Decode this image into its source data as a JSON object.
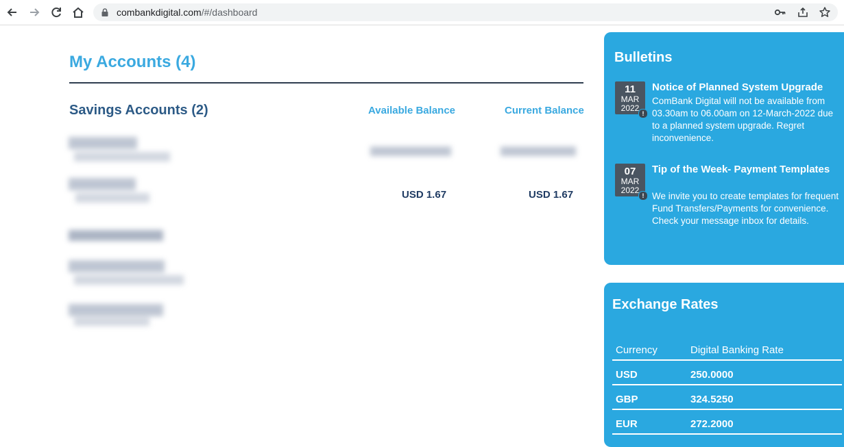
{
  "browser": {
    "url_host": "combankdigital.com",
    "url_path": "/#/dashboard"
  },
  "main": {
    "title": "My Accounts (4)",
    "savings_title": "Savings Accounts (2)",
    "col_available": "Available Balance",
    "col_current": "Current Balance",
    "accounts": [
      {
        "available": "",
        "current": ""
      },
      {
        "available": "USD 1.67",
        "current": "USD 1.67"
      }
    ]
  },
  "bulletins": {
    "title": "Bulletins",
    "items": [
      {
        "day": "11",
        "month": "MAR",
        "year": "2022",
        "title": "Notice of Planned System Upgrade",
        "text": "ComBank Digital will not be available from 03.30am to 06.00am on 12-March-2022 due to a planned system upgrade. Regret inconvenience."
      },
      {
        "day": "07",
        "month": "MAR",
        "year": "2022",
        "title": "Tip of the Week- Payment Templates",
        "text": "We invite you to create templates for frequent Fund Transfers/Payments for convenience. Check your message inbox for details."
      }
    ]
  },
  "rates": {
    "title": "Exchange Rates",
    "col_currency": "Currency",
    "col_rate": "Digital Banking Rate",
    "rows": [
      {
        "currency": "USD",
        "rate": "250.0000"
      },
      {
        "currency": "GBP",
        "rate": "324.5250"
      },
      {
        "currency": "EUR",
        "rate": "272.2000"
      }
    ]
  },
  "colors": {
    "accent": "#3aa9e0",
    "panel": "#2aa8e0",
    "heading": "#2c5a86"
  }
}
